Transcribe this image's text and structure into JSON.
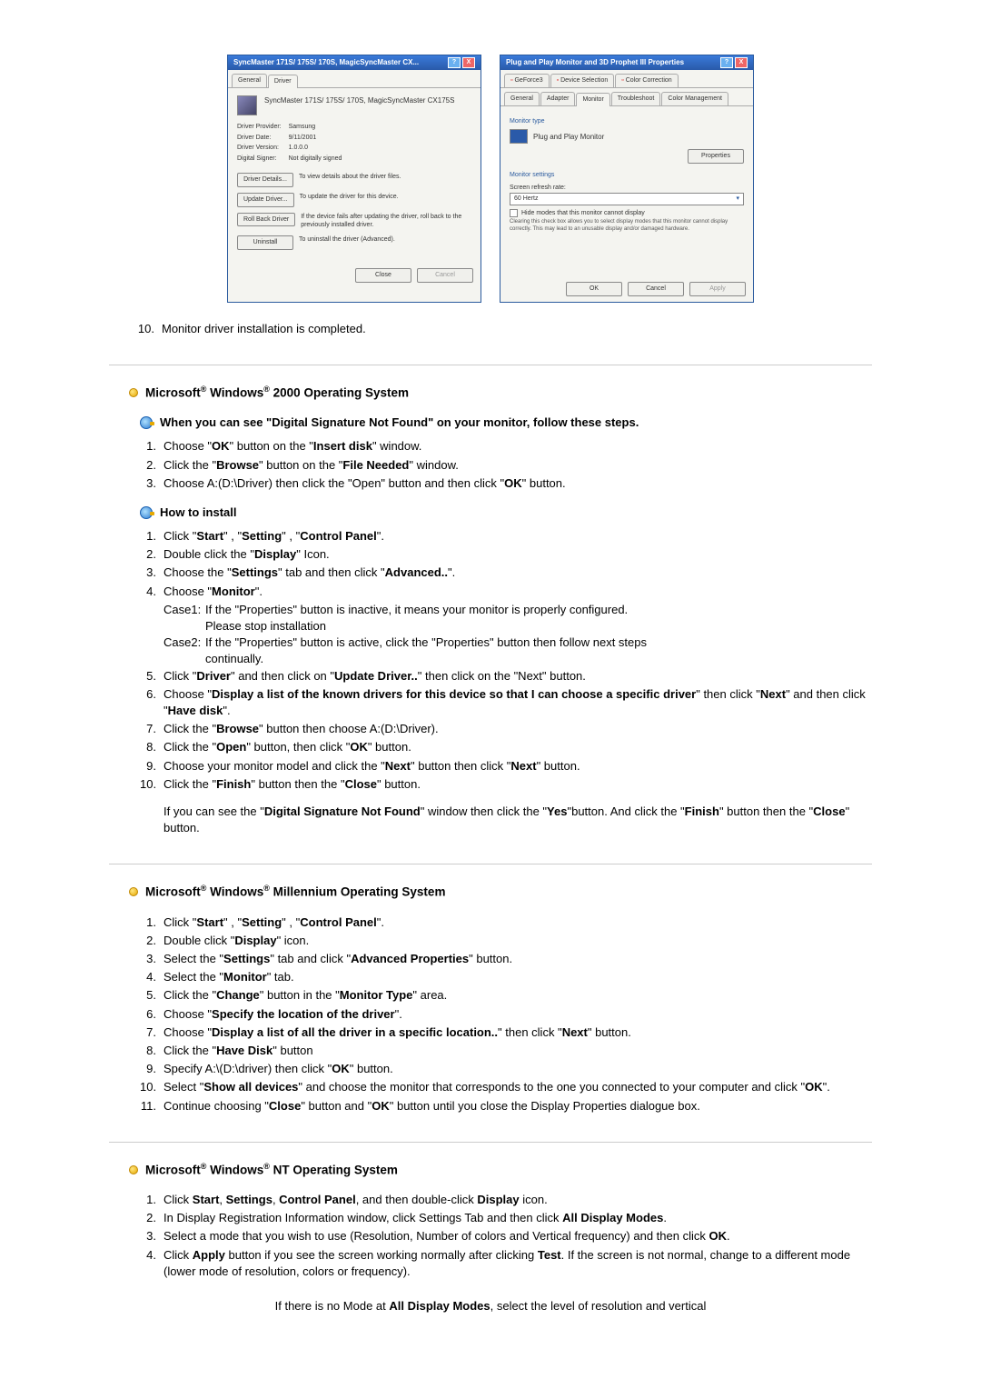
{
  "dialog1": {
    "title": "SyncMaster 171S/ 175S/ 170S, MagicSyncMaster CX...",
    "tabs": [
      "General",
      "Driver"
    ],
    "product": "SyncMaster 171S/ 175S/ 170S, MagicSyncMaster CX175S",
    "provider_label": "Driver Provider:",
    "provider": "Samsung",
    "date_label": "Driver Date:",
    "date": "9/11/2001",
    "version_label": "Driver Version:",
    "version": "1.0.0.0",
    "signer_label": "Digital Signer:",
    "signer": "Not digitally signed",
    "btn_details": "Driver Details...",
    "desc_details": "To view details about the driver files.",
    "btn_update": "Update Driver...",
    "desc_update": "To update the driver for this device.",
    "btn_rollback": "Roll Back Driver",
    "desc_rollback": "If the device fails after updating the driver, roll back to the previously installed driver.",
    "btn_uninstall": "Uninstall",
    "desc_uninstall": "To uninstall the driver (Advanced).",
    "close": "Close",
    "cancel": "Cancel"
  },
  "dialog2": {
    "title": "Plug and Play Monitor and 3D Prophet III Properties",
    "tabs_row1": [
      "GeForce3",
      "Device Selection",
      "Color Correction"
    ],
    "tabs_row2": [
      "General",
      "Adapter",
      "Monitor",
      "Troubleshoot",
      "Color Management"
    ],
    "section_type": "Monitor type",
    "monitor_name": "Plug and Play Monitor",
    "btn_props": "Properties",
    "section_settings": "Monitor settings",
    "refresh_label": "Screen refresh rate:",
    "refresh_value": "60 Hertz",
    "hide_modes": "Hide modes that this monitor cannot display",
    "hide_note": "Clearing this check box allows you to select display modes that this monitor cannot display correctly. This may lead to an unusable display and/or damaged hardware.",
    "ok": "OK",
    "cancel": "Cancel",
    "apply": "Apply"
  },
  "step10": "Monitor driver installation is completed.",
  "sec_2000": {
    "title_prefix": "Microsoft",
    "title_mid": " Windows",
    "title_suffix": " 2000 Operating System",
    "sub1": "When you can see \"Digital Signature Not Found\" on your monitor, follow these steps.",
    "s1": "Choose \"OK\" button on the \"Insert disk\" window.",
    "s2": "Click the \"Browse\" button on the \"File Needed\" window.",
    "s3": "Choose A:(D:\\Driver) then click the \"Open\" button and then click \"OK\" button.",
    "sub2": "How to install",
    "h1": "Click \"Start\" , \"Setting\" , \"Control Panel\".",
    "h2": "Double click the \"Display\" Icon.",
    "h3": "Choose the \"Settings\" tab and then click \"Advanced..\".",
    "h4": "Choose \"Monitor\".",
    "case1_label": "Case1:",
    "case1": "If the \"Properties\" button is inactive, it means your monitor is properly configured. Please stop installation",
    "case2_label": "Case2:",
    "case2": "If the \"Properties\" button is active, click the \"Properties\" button then follow next steps continually.",
    "h5": "Click \"Driver\" and then click on \"Update Driver..\" then click on the \"Next\" button.",
    "h6": "Choose \"Display a list of the known drivers for this device so that I can choose a specific driver\" then click \"Next\" and then click \"Have disk\".",
    "h7": "Click the \"Browse\" button then choose A:(D:\\Driver).",
    "h8": "Click the \"Open\" button, then click \"OK\" button.",
    "h9": "Choose your monitor model and click the \"Next\" button then click \"Next\" button.",
    "h10": "Click the \"Finish\" button then the \"Close\" button.",
    "note": "If you can see the \"Digital Signature Not Found\" window then click the \"Yes\"button. And click the \"Finish\" button then the \"Close\" button."
  },
  "sec_me": {
    "title_suffix": " Millennium Operating System",
    "m1": "Click \"Start\" , \"Setting\" , \"Control Panel\".",
    "m2": "Double click \"Display\" icon.",
    "m3": "Select the \"Settings\" tab and click \"Advanced Properties\" button.",
    "m4": "Select the \"Monitor\" tab.",
    "m5": "Click the \"Change\" button in the \"Monitor Type\" area.",
    "m6": "Choose \"Specify the location of the driver\".",
    "m7": "Choose \"Display a list of all the driver in a specific location..\" then click \"Next\" button.",
    "m8": "Click the \"Have Disk\" button",
    "m9": "Specify A:\\(D:\\driver) then click \"OK\" button.",
    "m10": "Select \"Show all devices\" and choose the monitor that corresponds to the one you connected to your computer and click \"OK\".",
    "m11": "Continue choosing \"Close\" button and \"OK\" button until you close the Display Properties dialogue box."
  },
  "sec_nt": {
    "title_suffix": " NT Operating System",
    "n1": "Click Start, Settings, Control Panel, and then double-click Display icon.",
    "n2": "In Display Registration Information window, click Settings Tab and then click All Display Modes.",
    "n3": "Select a mode that you wish to use (Resolution, Number of colors and Vertical frequency) and then click OK.",
    "n4": "Click Apply button if you see the screen working normally after clicking Test. If the screen is not normal, change to a different mode (lower mode of resolution, colors or frequency).",
    "note": "If there is no Mode at All Display Modes, select the level of resolution and vertical"
  }
}
